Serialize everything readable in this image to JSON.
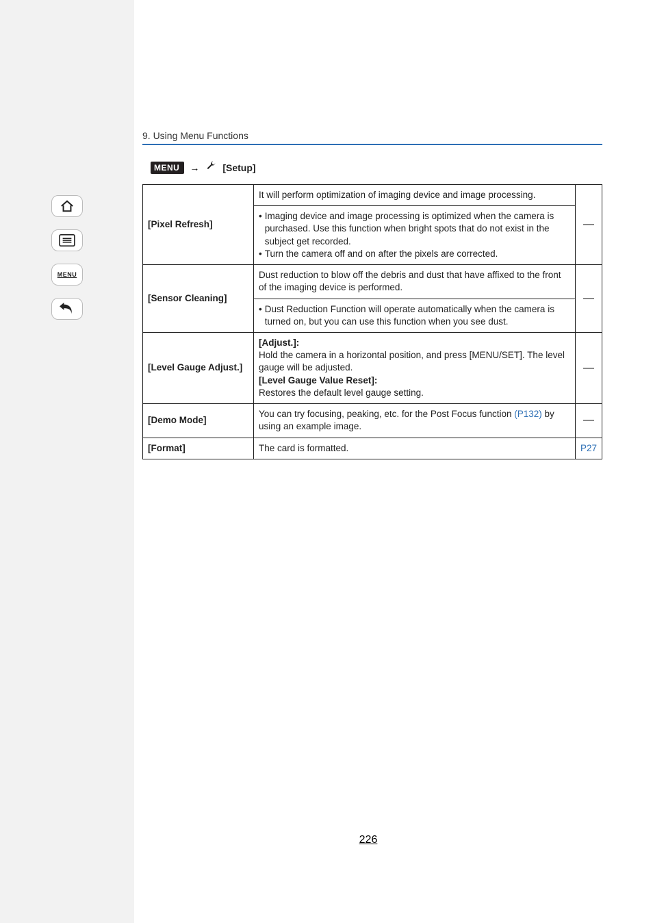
{
  "breadcrumb": "9. Using Menu Functions",
  "menu_path": {
    "menu_badge": "MENU",
    "arrow": "→",
    "setup_label": "[Setup]"
  },
  "table": {
    "rows": {
      "pixel_refresh": {
        "name": "[Pixel Refresh]",
        "desc_top": "It will perform optimization of imaging device and image processing.",
        "bullets": [
          "Imaging device and image processing is optimized when the camera is purchased. Use this function when bright spots that do not exist in the subject get recorded.",
          "Turn the camera off and on after the pixels are corrected."
        ],
        "ref": "—"
      },
      "sensor_cleaning": {
        "name": "[Sensor Cleaning]",
        "desc_top": "Dust reduction to blow off the debris and dust that have affixed to the front of the imaging device is performed.",
        "bullets": [
          "Dust Reduction Function will operate automatically when the camera is turned on, but you can use this function when you see dust."
        ],
        "ref": "—"
      },
      "level_gauge": {
        "name": "[Level Gauge Adjust.]",
        "adjust_label": "[Adjust.]:",
        "adjust_text": "Hold the camera in a horizontal position, and press [MENU/SET]. The level gauge will be adjusted.",
        "reset_label": "[Level Gauge Value Reset]:",
        "reset_text": "Restores the default level gauge setting.",
        "ref": "—"
      },
      "demo_mode": {
        "name": "[Demo Mode]",
        "text_before": "You can try focusing, peaking, etc. for the Post Focus function ",
        "link": "(P132)",
        "text_after": " by using an example image.",
        "ref": "—"
      },
      "format": {
        "name": "[Format]",
        "text": "The card is formatted.",
        "ref": "P27"
      }
    }
  },
  "page_number": "226",
  "sidebar": {
    "menu_label": "MENU"
  }
}
